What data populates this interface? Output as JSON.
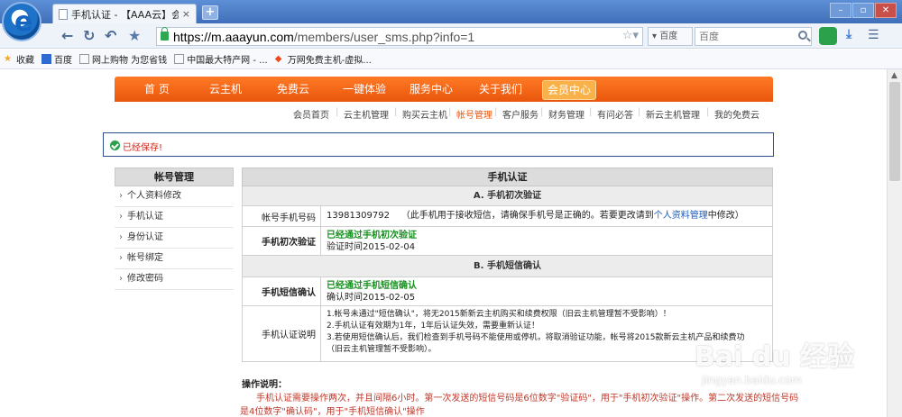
{
  "browser": {
    "tab_title": "手机认证 - 【AAA云】会员",
    "tab_close": "×",
    "new_tab": "+",
    "url_host": "https://m.aaayun.com",
    "url_path": "/members/user_sms.php?info=1",
    "search_engine": "百度",
    "search_placeholder": "百度",
    "win_min": "–",
    "win_max": "▫",
    "win_close": "✕",
    "favorites": [
      {
        "label": "收藏",
        "icon": "star-icon"
      },
      {
        "label": "百度",
        "icon": "baidu-icon"
      },
      {
        "label": "网上购物 为您省钱",
        "icon": "page-icon"
      },
      {
        "label": "中国最大特产网 - ...",
        "icon": "page-icon"
      },
      {
        "label": "万网免费主机-虚拟...",
        "icon": "diamond-icon"
      }
    ]
  },
  "main_nav": [
    "首 页",
    "云主机",
    "免费云",
    "一键体验",
    "服务中心",
    "关于我们",
    "会员中心"
  ],
  "sub_nav": [
    "会员首页",
    "云主机管理",
    "购买云主机",
    "帐号管理",
    "客户服务",
    "财务管理",
    "有问必答",
    "新云主机管理",
    "我的免费云"
  ],
  "notice": "已经保存!",
  "sidebar": {
    "title": "帐号管理",
    "items": [
      "个人资料修改",
      "手机认证",
      "身份认证",
      "帐号绑定",
      "修改密码"
    ]
  },
  "content": {
    "title": "手机认证",
    "section_a": "A. 手机初次验证",
    "phone_label": "帐号手机号码",
    "phone_number": "13981309792",
    "phone_note_pre": "（此手机用于接收短信，请确保手机号是正确的。若要更改请到",
    "phone_note_link": "个人资料管理",
    "phone_note_post": "中修改）",
    "first_verify_label": "手机初次验证",
    "first_verify_status": "已经通过手机初次验证",
    "first_verify_time": "验证时间2015-02-04",
    "section_b": "B. 手机短信确认",
    "sms_confirm_label": "手机短信确认",
    "sms_confirm_status": "已经通过手机短信确认",
    "sms_confirm_time": "确认时间2015-02-05",
    "notes_label": "手机认证说明",
    "notes": [
      "1.帐号未通过\"短信确认\"，将无2015新新云主机购买和续费权限（旧云主机管理暂不受影响）！",
      "2.手机认证有效期为1年，1年后认证失效，需要重新认证！",
      "3.若使用短信确认后，我们检查到手机号码不能使用或停机，将取消验证功能，帐号将2015款新云主机产品和续费功",
      "（旧云主机管理暂不受影响）。"
    ]
  },
  "ops": {
    "title": "操作说明：",
    "line1": "手机认证需要操作两次，并且间隔6小时。第一次发送的短信号码是6位数字\"验证码\"，用于\"手机初次验证\"操作。第二次发送的短信号码",
    "line2": "是4位数字\"确认码\"，用于\"手机短信确认\"操作"
  },
  "watermark": {
    "brand": "Bai du 经验",
    "url": "jingyan.baidu.com"
  }
}
